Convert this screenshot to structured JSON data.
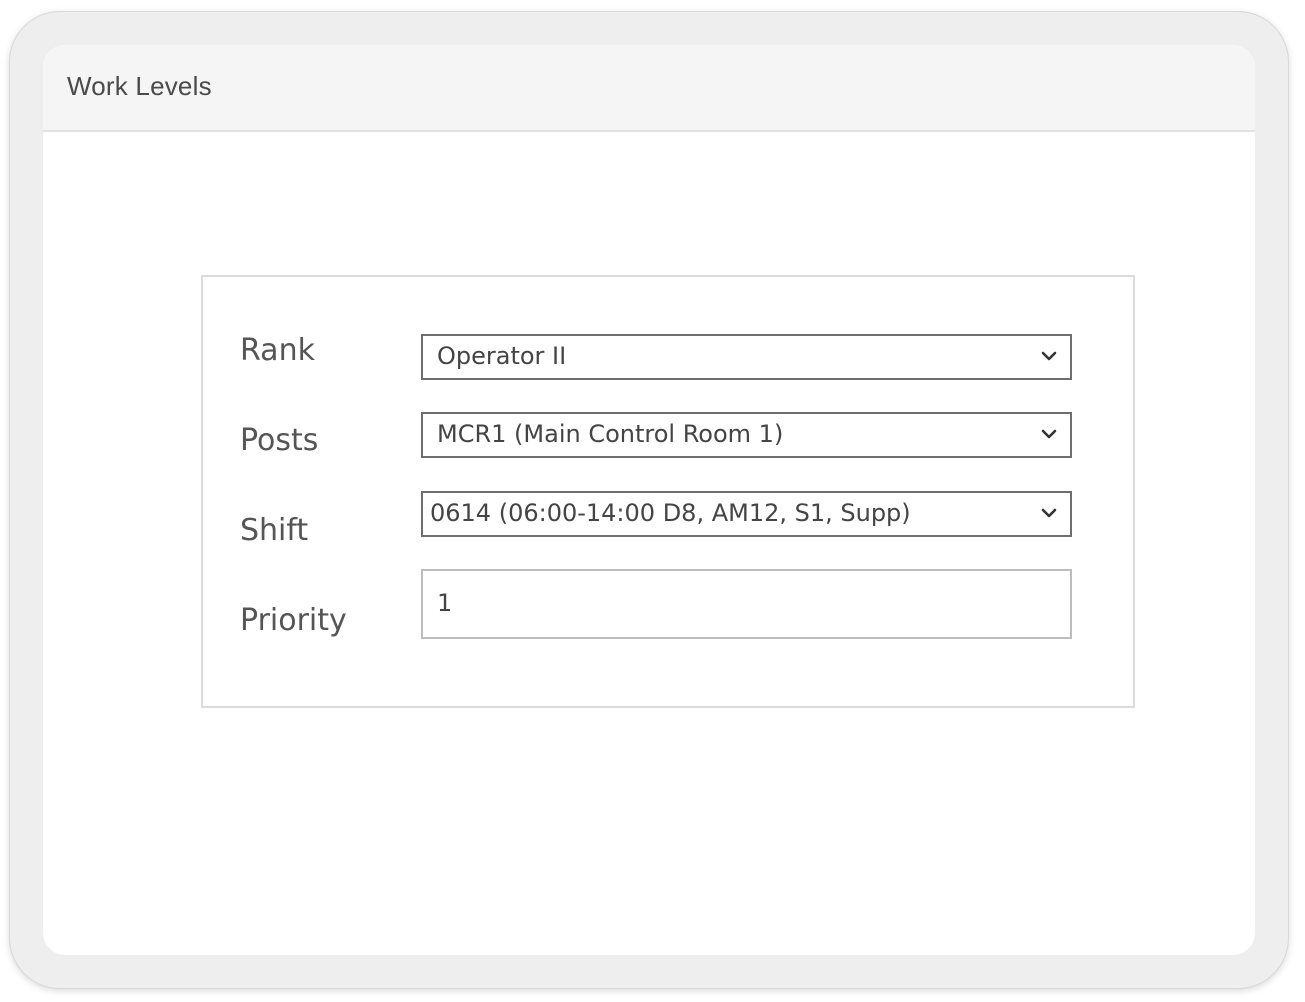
{
  "header": {
    "title": "Work Levels"
  },
  "form": {
    "rank": {
      "label": "Rank",
      "value": "Operator II",
      "icon": "chevron-down-icon"
    },
    "posts": {
      "label": "Posts",
      "value": "MCR1 (Main Control Room 1)",
      "icon": "chevron-down-icon"
    },
    "shift": {
      "label": "Shift",
      "value": "0614 (06:00-14:00 D8, AM12, S1, Supp)",
      "icon": "chevron-down-icon"
    },
    "priority": {
      "label": "Priority",
      "value": "1"
    }
  },
  "colors": {
    "header_bg": "#f5f5f5",
    "frame_bg": "#eeeeee",
    "text": "#444444"
  }
}
